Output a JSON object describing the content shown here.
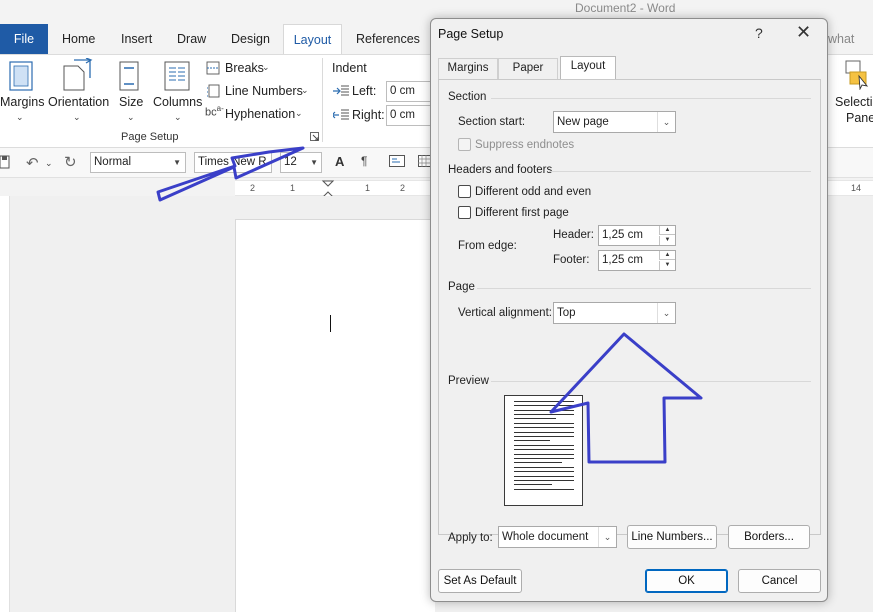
{
  "window": {
    "doc_title": "Document2  -  Word"
  },
  "tabs": [
    {
      "id": "file",
      "label": "File"
    },
    {
      "id": "home",
      "label": "Home"
    },
    {
      "id": "insert",
      "label": "Insert"
    },
    {
      "id": "draw",
      "label": "Draw"
    },
    {
      "id": "design",
      "label": "Design"
    },
    {
      "id": "layout",
      "label": "Layout"
    },
    {
      "id": "references",
      "label": "References"
    },
    {
      "id": "tellme",
      "label": "what you"
    }
  ],
  "ribbon": {
    "margins": "Margins",
    "orientation": "Orientation",
    "size": "Size",
    "columns": "Columns",
    "breaks": "Breaks",
    "line_numbers": "Line Numbers",
    "hyphenation": "Hyphenation",
    "group_page_setup": "Page Setup",
    "indent": "Indent",
    "left_label": "Left:",
    "left_value": "0 cm",
    "right_label": "Right:",
    "right_value": "0 cm",
    "selection": "Selection",
    "pane": "Pane"
  },
  "toolbar": {
    "style": "Normal",
    "font": "Times New R",
    "size": "12"
  },
  "ruler": {
    "labels": [
      "2",
      "1",
      "1",
      "2",
      "14"
    ]
  },
  "dialog": {
    "title": "Page Setup",
    "help": "?",
    "close": "✕",
    "tabs": [
      "Margins",
      "Paper",
      "Layout"
    ],
    "section": {
      "heading": "Section",
      "section_start_label": "Section start:",
      "section_start_value": "New page",
      "suppress_endnotes": "Suppress endnotes"
    },
    "headers_footers": {
      "heading": "Headers and footers",
      "diff_odd_even": "Different odd and even",
      "diff_first_page": "Different first page",
      "from_edge": "From edge:",
      "header_label": "Header:",
      "header_value": "1,25 cm",
      "footer_label": "Footer:",
      "footer_value": "1,25 cm"
    },
    "page": {
      "heading": "Page",
      "valign_label": "Vertical alignment:",
      "valign_value": "Top"
    },
    "preview": {
      "heading": "Preview"
    },
    "apply": {
      "label": "Apply to:",
      "value": "Whole document",
      "line_numbers": "Line Numbers...",
      "borders": "Borders..."
    },
    "buttons": {
      "set_default": "Set As Default",
      "ok": "OK",
      "cancel": "Cancel"
    }
  },
  "colors": {
    "accent": "#1f5ba6",
    "annotation_arrow": "#3a3fc8",
    "default_button_border": "#0067c0"
  }
}
